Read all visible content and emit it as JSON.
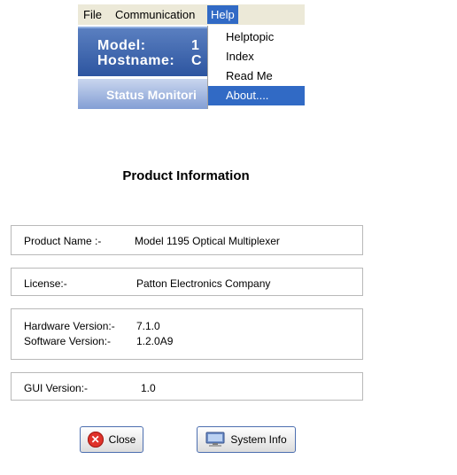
{
  "menubar": {
    "items": [
      "File",
      "Communication",
      "Help"
    ],
    "active": "Help"
  },
  "app_header": {
    "model_label": "Model:",
    "model_value_partial": "1",
    "hostname_label": "Hostname:",
    "hostname_value_partial": "C",
    "status_label": "Status Monitori"
  },
  "help_menu": {
    "items": [
      "Helptopic",
      "Index",
      "Read Me",
      "About...."
    ],
    "highlighted": "About...."
  },
  "dialog": {
    "title": "Product Information",
    "product_name_label": "Product Name :-",
    "product_name_value": "Model 1195 Optical Multiplexer",
    "license_label": "License:-",
    "license_value": "Patton Electronics Company",
    "hardware_label": "Hardware Version:-",
    "hardware_value": "7.1.0",
    "software_label": "Software Version:-",
    "software_value": "1.2.0A9",
    "gui_label": "GUI Version:-",
    "gui_value": "1.0",
    "close_button": "Close",
    "sysinfo_button": "System Info"
  },
  "colors": {
    "menu_highlight": "#316ac5",
    "menubar_bg": "#ece9d8",
    "close_icon": "#e0322a"
  }
}
